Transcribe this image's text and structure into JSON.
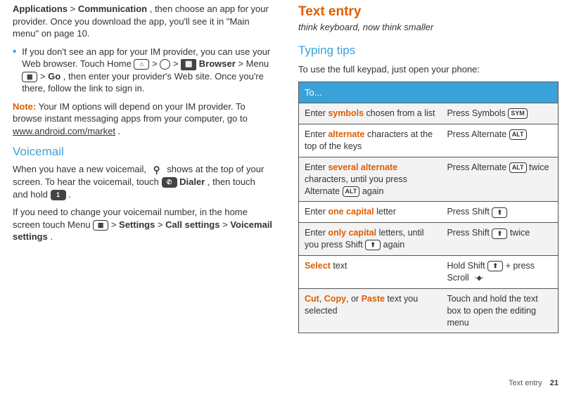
{
  "left": {
    "frag1_a": "Applications",
    "frag1_sep1": " > ",
    "frag1_b": "Communication",
    "frag1_rest": ", then choose an app for your provider. Once you download the app, you'll see it in \"Main menu\" on page 10.",
    "bullet2_a": "If you don't see an app for your IM provider, you can use your Web browser. Touch Home ",
    "bullet2_b": " > ",
    "bullet2_c": " > ",
    "bullet2_browser": "Browser",
    "bullet2_d": " > Menu ",
    "bullet2_e": " > ",
    "bullet2_go": "Go",
    "bullet2_f": ", then enter your provider's Web site. Once you're there, follow the link to sign in.",
    "note_label": "Note:",
    "note_text": " Your IM options will depend on your IM provider. To browse instant messaging apps from your computer, go to ",
    "note_link": "www.android.com/market",
    "note_end": ".",
    "vm_heading": "Voicemail",
    "vm_p1_a": "When you have a new voicemail, ",
    "vm_p1_b": " shows at the top of your screen. To hear the voicemail, touch ",
    "vm_dialer": "Dialer",
    "vm_p1_c": ", then touch and hold ",
    "vm_p1_d": ".",
    "vm_p2_a": "If you need to change your voicemail number, in the home screen touch Menu ",
    "vm_p2_b": " > ",
    "vm_settings": "Settings",
    "vm_p2_c": " > ",
    "vm_callsettings": "Call settings",
    "vm_p2_d": " > ",
    "vm_vmsettings": "Voicemail settings",
    "vm_p2_e": "."
  },
  "right": {
    "te_heading": "Text entry",
    "tagline": "think keyboard, now think smaller",
    "tt_heading": "Typing tips",
    "tt_intro": "To use the full keypad, just open your phone:",
    "table_header": "To...",
    "rows": [
      {
        "a_pre": "Enter ",
        "a_kw": "symbols",
        "a_post": " chosen from a list",
        "b_pre": "Press Symbols ",
        "b_icon": "SYM"
      },
      {
        "a_pre": "Enter ",
        "a_kw": "alternate",
        "a_post": " characters at the top of the keys",
        "b_pre": "Press Alternate ",
        "b_icon": "ALT"
      },
      {
        "a_pre": "Enter ",
        "a_kw": "several alternate",
        "a_post1": " characters, until you press Alternate ",
        "a_icon": "ALT",
        "a_post2": " again",
        "b_pre": "Press Alternate ",
        "b_icon": "ALT",
        "b_post": " twice"
      },
      {
        "a_pre": "Enter ",
        "a_kw": "one capital",
        "a_post": " letter",
        "b_pre": "Press Shift ",
        "b_icon": "⬆"
      },
      {
        "a_pre": "Enter ",
        "a_kw": "only capital",
        "a_post1": " letters, until you press Shift ",
        "a_icon": "⬆",
        "a_post2": " again",
        "b_pre": "Press Shift ",
        "b_icon": "⬆",
        "b_post": " twice"
      },
      {
        "a_kw": "Select",
        "a_post": " text",
        "b_pre": "Hold Shift ",
        "b_icon": "⬆",
        "b_post": " + press Scroll ",
        "b_scroll": true
      },
      {
        "a_kw1": "Cut",
        "a_sep1": ", ",
        "a_kw2": "Copy",
        "a_sep2": ", or ",
        "a_kw3": "Paste",
        "a_post": " text you selected",
        "b_plain": "Touch and hold the text box to open the editing menu"
      }
    ]
  },
  "footer": {
    "label": "Text entry",
    "page": "21"
  },
  "icons": {
    "home": "⌂",
    "circle": "◉",
    "menu": "▦",
    "key1": "1",
    "dialer": "✆",
    "vm": "⚲",
    "alt": "ALT",
    "sym": "SYM",
    "shift": "⬆"
  }
}
